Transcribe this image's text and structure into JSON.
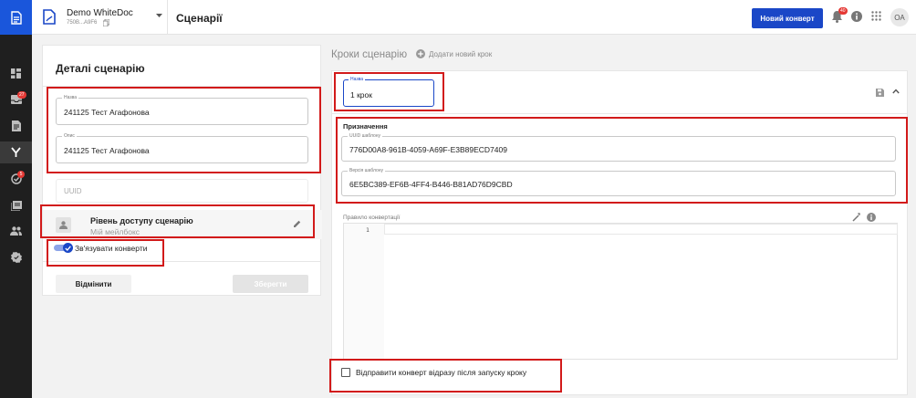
{
  "sidebar": {
    "logo_icon": "document-icon",
    "items": [
      {
        "icon": "dashboard-icon",
        "badge": ""
      },
      {
        "icon": "inbox-icon",
        "badge": "27"
      },
      {
        "icon": "document-list-icon",
        "badge": ""
      },
      {
        "icon": "scenario-branch-icon",
        "badge": "",
        "active": true
      },
      {
        "icon": "tasks-icon",
        "badge": "5"
      },
      {
        "icon": "library-icon",
        "badge": ""
      },
      {
        "icon": "users-icon",
        "badge": ""
      },
      {
        "icon": "settings-badge-icon",
        "badge": ""
      }
    ]
  },
  "header": {
    "workspace_name": "Demo WhiteDoc",
    "workspace_id": "750B...A9F6",
    "page_title": "Сценарії",
    "new_envelope_label": "Новий конверт",
    "notifications_badge": "40",
    "avatar_initials": "ОА"
  },
  "details": {
    "title": "Деталі сценарію",
    "name_label": "Назва",
    "name_value": "241125 Тест Агафонова",
    "description_label": "Опис",
    "description_value": "241125 Тест Агафонова",
    "uuid_placeholder": "UUID",
    "access_title": "Рівень доступу сценарію",
    "access_subtitle": "Мій мейлбокс",
    "link_envelopes_label": "Зв'язувати конверти",
    "cancel_label": "Відмінити",
    "save_label": "Зберегти"
  },
  "steps": {
    "title": "Кроки сценарію",
    "add_step_label": "Додати новий крок",
    "step_name_label": "Назва",
    "step_name_value": "1 крок",
    "destination_label": "Призначення",
    "template_uuid_label": "UUID шаблону",
    "template_uuid_value": "776D00A8-961B-4059-A69F-E3B89ECD7409",
    "template_version_label": "Версія шаблону",
    "template_version_value": "6E5BC389-EF6B-4FF4-B446-B81AD76D9CBD",
    "conversion_rule_label": "Правило конвертації",
    "line_number": "1",
    "send_immediately_label": "Відправити конверт відразу після запуску кроку"
  },
  "colors": {
    "brand_blue": "#1a47c7",
    "highlight_red": "#d21a1a",
    "sidebar_bg": "#1f1f1f"
  }
}
